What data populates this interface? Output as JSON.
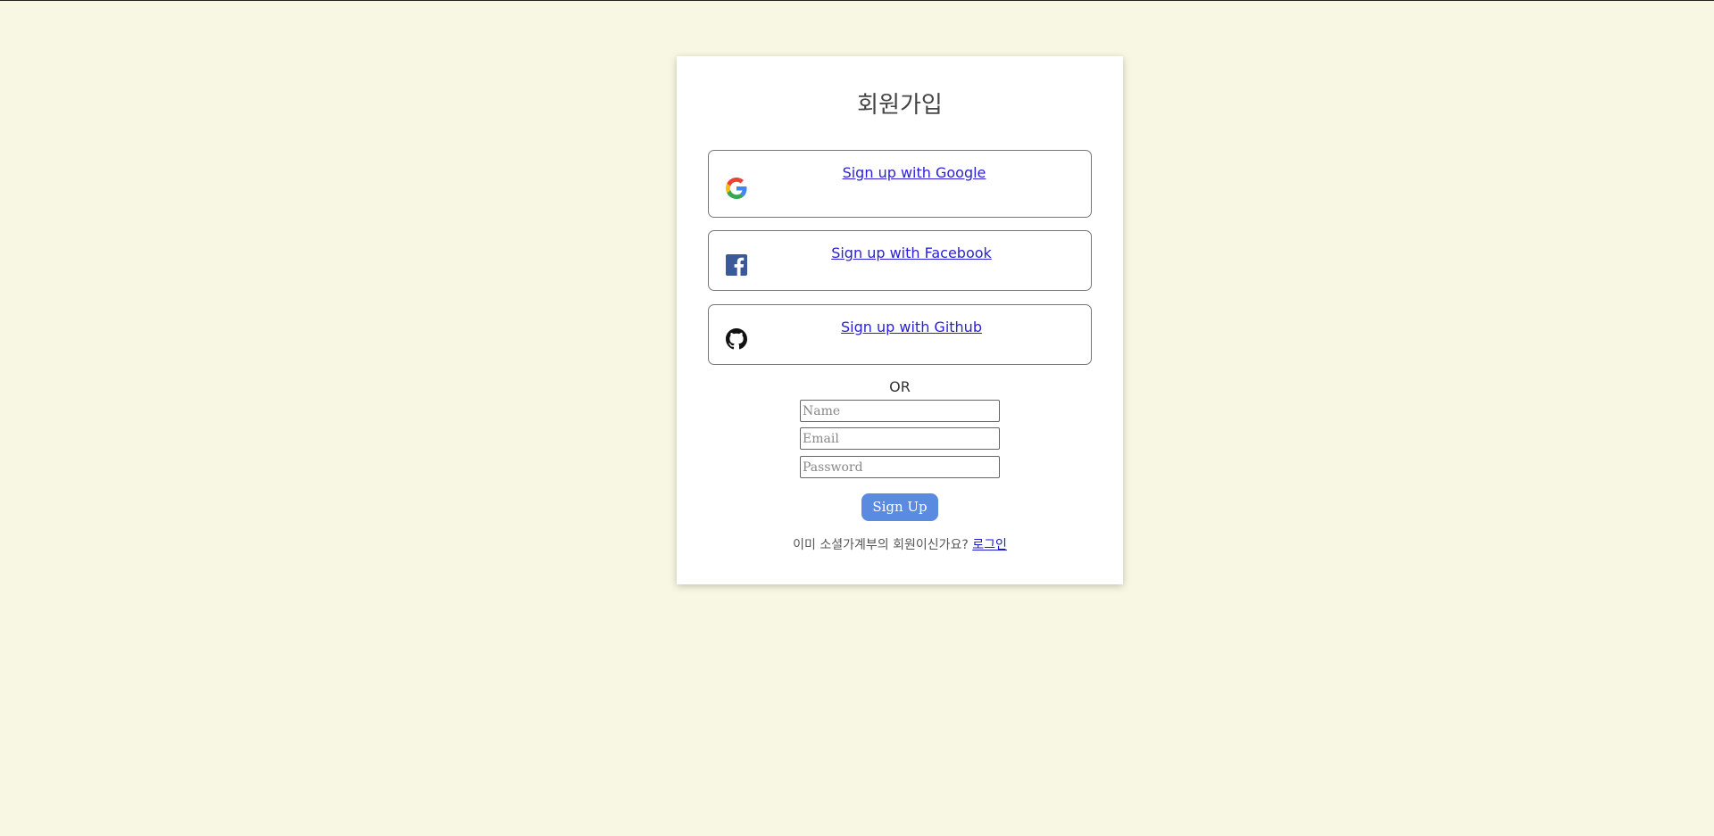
{
  "page": {
    "title": "회원가입"
  },
  "social": {
    "google": {
      "label": "Sign up with Google",
      "icon": "google-icon"
    },
    "facebook": {
      "label": "Sign up with Facebook",
      "icon": "facebook-icon",
      "color": "#3b5998"
    },
    "github": {
      "label": "Sign up with Github",
      "icon": "github-icon"
    }
  },
  "divider": {
    "text": "OR"
  },
  "form": {
    "name_placeholder": "Name",
    "email_placeholder": "Email",
    "password_placeholder": "Password",
    "submit_label": "Sign Up",
    "submit_color": "#5b8be0"
  },
  "footer": {
    "prompt": "이미 소셜가계부의 회원이신가요? ",
    "login_link": "로그인"
  },
  "colors": {
    "background": "#f8f7e3",
    "card": "#ffffff",
    "link": "#2a1fd8"
  }
}
